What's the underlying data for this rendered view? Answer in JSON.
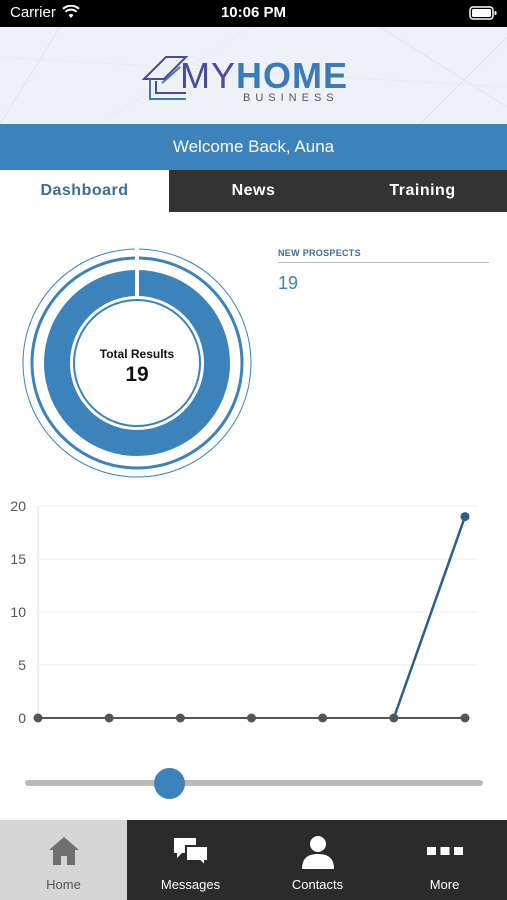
{
  "status_bar": {
    "carrier": "Carrier",
    "time": "10:06 PM"
  },
  "header": {
    "logo_my": "MY",
    "logo_home": "HOME",
    "logo_sub": "BUSINESS"
  },
  "welcome": "Welcome Back, Auna",
  "tabs": [
    {
      "label": "Dashboard",
      "active": true
    },
    {
      "label": "News",
      "active": false
    },
    {
      "label": "Training",
      "active": false
    }
  ],
  "summary": {
    "total_label": "Total Results",
    "total_value": "19"
  },
  "prospects": {
    "label": "NEW PROSPECTS",
    "value": "19"
  },
  "chart_data": {
    "type": "line",
    "x": [
      1,
      2,
      3,
      4,
      5,
      6,
      7
    ],
    "series": [
      {
        "values": [
          0,
          0,
          0,
          0,
          0,
          0,
          19
        ]
      }
    ],
    "yticks": [
      "0",
      "5",
      "10",
      "15",
      "20"
    ],
    "ylim": [
      0,
      20
    ],
    "grid": true,
    "colors": {
      "line": "#2f5f86",
      "flat": "#555555"
    }
  },
  "slider": {
    "value": 0.32
  },
  "tabbar": [
    {
      "label": "Home",
      "icon": "home-icon",
      "active": true
    },
    {
      "label": "Messages",
      "icon": "messages-icon",
      "active": false
    },
    {
      "label": "Contacts",
      "icon": "contacts-icon",
      "active": false
    },
    {
      "label": "More",
      "icon": "more-icon",
      "active": false
    }
  ],
  "colors": {
    "accent": "#3c83bb",
    "tab_bg": "#333333"
  }
}
